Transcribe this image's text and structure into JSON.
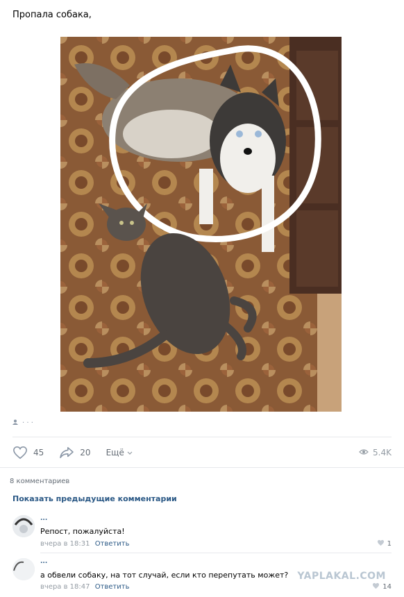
{
  "post": {
    "text": "Пропала собака,",
    "meta_text": "· · ·",
    "likes": "45",
    "reposts": "20",
    "more_label": "Ещё",
    "views": "5.4K"
  },
  "comments_section": {
    "count_label": "8 комментариев",
    "show_previous_label": "Показать предыдущие комментарии",
    "items": [
      {
        "author": "...",
        "text": "Репост, пожалуйста!",
        "time": "вчера в 18:31",
        "reply_label": "Ответить",
        "likes": "1"
      },
      {
        "author": "...",
        "text": "а обвели собаку, на тот случай, если кто перепутать может?",
        "time": "вчера в 18:47",
        "reply_label": "Ответить",
        "likes": "14"
      }
    ]
  },
  "watermark": "YAPLAKAL.COM",
  "colors": {
    "link": "#2a5885",
    "muted": "#939ba3",
    "divider": "#e7e8ec"
  }
}
